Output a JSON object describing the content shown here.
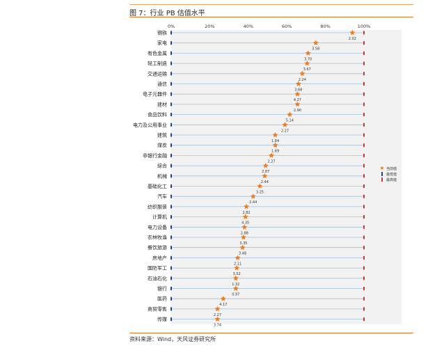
{
  "figure": {
    "title": "图 7：行业 PB 估值水平",
    "source": "资料来源：Wind，天风证券研究所"
  },
  "legend": {
    "current": "当前值",
    "min": "最低值",
    "max": "最高值"
  },
  "colors": {
    "current_marker": "#f07a1a",
    "min_marker": "#1f3f8f",
    "max_marker": "#c0392b",
    "row_line": "#9fbfdf",
    "accent_rule": "#e07820"
  },
  "chart_data": {
    "type": "scatter",
    "title": "",
    "x_axis": {
      "ticks": [
        "0%",
        "20%",
        "40%",
        "60%",
        "80%",
        "100%"
      ],
      "range": [
        0,
        100
      ],
      "unit": "%"
    },
    "categories": [
      "钢铁",
      "家电",
      "有色金属",
      "轻工制造",
      "交通运输",
      "通信",
      "电子元器件",
      "建材",
      "食品饮料",
      "电力及公用事业",
      "建筑",
      "煤炭",
      "非银行金融",
      "综合",
      "机械",
      "基础化工",
      "汽车",
      "纺织服装",
      "计算机",
      "电力设备",
      "农林牧渔",
      "餐饮旅游",
      "房地产",
      "国防军工",
      "石油石化",
      "银行",
      "医药",
      "商贸零售",
      "传媒"
    ],
    "current_percentile": [
      94,
      75,
      71,
      70.5,
      68,
      66,
      65.5,
      65.5,
      61.5,
      59,
      54,
      54,
      52,
      49,
      48.5,
      46,
      42.5,
      39,
      38.5,
      38,
      37.5,
      37,
      34.5,
      34,
      33.5,
      33.5,
      27,
      24,
      24
    ],
    "current_pb": [
      "2.02",
      "3.58",
      "3.70",
      "3.67",
      "2.24",
      "3.68",
      "4.27",
      "2.90",
      "5.14",
      "2.27",
      "1.84",
      "1.69",
      "2.27",
      "2.87",
      "2.44",
      "3.25",
      "2.44",
      "2.82",
      "4.35",
      "2.88",
      "3.35",
      "3.48",
      "2.11",
      "3.52",
      "1.32",
      "0.97",
      "4.17",
      "2.27",
      "3.74"
    ],
    "min_percentile": 0,
    "max_percentile": 100
  }
}
